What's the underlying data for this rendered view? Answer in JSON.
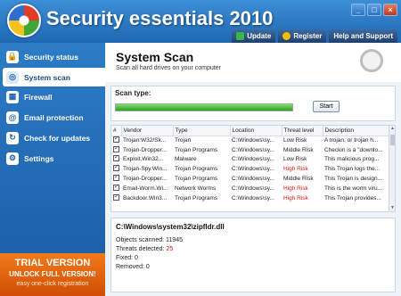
{
  "app": {
    "title": "Security essentials 2010"
  },
  "window_buttons": [
    "_",
    "□",
    "×"
  ],
  "topnav": [
    {
      "label": "Update",
      "icon": "update-icon"
    },
    {
      "label": "Register",
      "icon": "key-icon"
    },
    {
      "label": "Help and Support",
      "icon": ""
    }
  ],
  "sidebar": {
    "items": [
      {
        "label": "Security status",
        "icon": "lock-icon",
        "active": false
      },
      {
        "label": "System scan",
        "icon": "scan-icon",
        "active": true
      },
      {
        "label": "Firewall",
        "icon": "firewall-icon",
        "active": false
      },
      {
        "label": "Email protection",
        "icon": "email-icon",
        "active": false
      },
      {
        "label": "Check for updates",
        "icon": "update-icon",
        "active": false
      },
      {
        "label": "Settings",
        "icon": "gear-icon",
        "active": false
      }
    ]
  },
  "trial": {
    "line1": "TRIAL VERSION",
    "line2": "UNLOCK FULL VERSION!",
    "line3": "easy one-click registration",
    "color": "#e8640e"
  },
  "main": {
    "title": "System Scan",
    "subtitle": "Scan all hard drives on your computer",
    "scan_label": "Scan type:",
    "progress": 1.0,
    "start_label": "Start"
  },
  "table": {
    "columns": [
      "#",
      "Vendor",
      "Type",
      "Location",
      "Threat level",
      "Description"
    ],
    "rows": [
      {
        "vendor": "Trojan:W32/Sk...",
        "type": "Trojan",
        "location": "C:\\Windows\\sy...",
        "level": "Low Risk",
        "high": false,
        "desc": "A trojan, or trojan h..."
      },
      {
        "vendor": "Trojan-Dropper...",
        "type": "Trojan Programs",
        "location": "C:\\Windows\\sy...",
        "level": "Middle Risk",
        "high": false,
        "desc": "Checkin is a \"downlo..."
      },
      {
        "vendor": "Exploit.Win32...",
        "type": "Malware",
        "location": "C:\\Windows\\sy...",
        "level": "Low Risk",
        "high": false,
        "desc": "This malicious prog..."
      },
      {
        "vendor": "Trojan-Spy.Win...",
        "type": "Trojan Programs",
        "location": "C:\\Windows\\sy...",
        "level": "High Risk",
        "high": true,
        "desc": "This Trojan logs the..."
      },
      {
        "vendor": "Trojan-Dropper...",
        "type": "Trojan Programs",
        "location": "C:\\Windows\\sy...",
        "level": "Middle Risk",
        "high": false,
        "desc": "This Trojan is design..."
      },
      {
        "vendor": "Email-Worm.Wi...",
        "type": "Network Worms",
        "location": "C:\\Windows\\sy...",
        "level": "High Risk",
        "high": true,
        "desc": "This is the worm viru..."
      },
      {
        "vendor": "Backdoor.Win3...",
        "type": "Trojan Programs",
        "location": "C:\\Windows\\sy...",
        "level": "High Risk",
        "high": true,
        "desc": "This Trojan provides..."
      }
    ]
  },
  "scan_info": {
    "path": "C:\\Windows\\system32\\zipfldr.dll",
    "objects_label": "Objects scanned: ",
    "objects_value": "11945",
    "threats_label": "Threats detected: ",
    "threats_value": "25",
    "fixed": "Fixed: 0",
    "removed": "Removed: 0"
  }
}
